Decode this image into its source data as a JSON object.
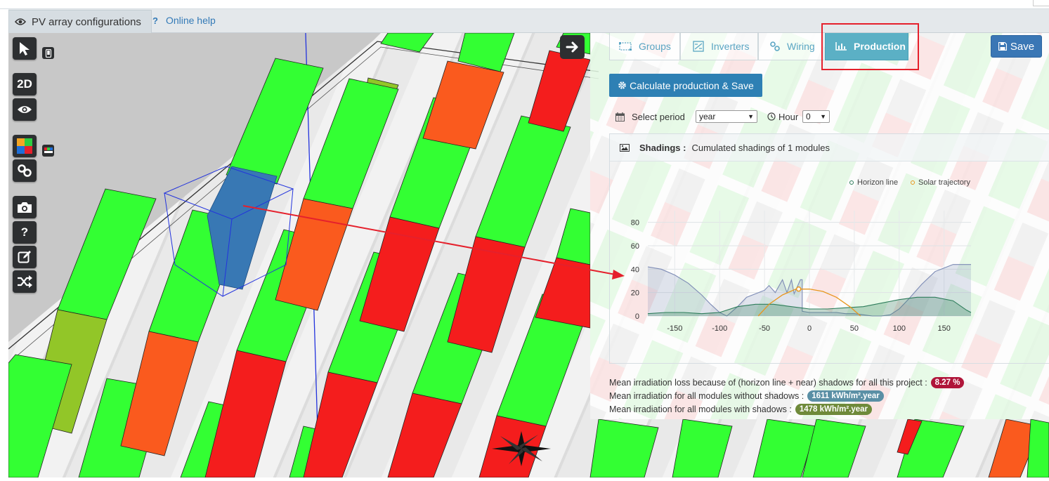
{
  "header": {
    "tab_label": "PV array configurations",
    "help_label": "Online help"
  },
  "toolbar": {
    "view_2d_label": "2D",
    "help_glyph": "?",
    "icons": [
      "cursor-icon",
      "mobile-icon",
      "eye-icon",
      "color-palette-icon",
      "color-bar-icon",
      "link-icon",
      "camera-icon",
      "question-icon",
      "edit-icon",
      "shuffle-icon",
      "arrow-right-icon"
    ]
  },
  "panel": {
    "tabs": [
      {
        "label": "Groups",
        "icon": "groups-icon"
      },
      {
        "label": "Inverters",
        "icon": "inverter-icon"
      },
      {
        "label": "Wiring",
        "icon": "wiring-icon"
      },
      {
        "label": "Production",
        "icon": "bar-chart-icon",
        "active": true
      }
    ],
    "save_label": "Save",
    "calculate_label": "Calculate production & Save",
    "select_period_label": "Select period",
    "period_value": "year",
    "hour_label": "Hour",
    "hour_value": "0"
  },
  "shadings": {
    "title": "Shadings :",
    "subtitle": "Cumulated shadings of 1 modules"
  },
  "chart_data": {
    "type": "area",
    "title": "",
    "xlabel": "",
    "ylabel": "",
    "xlim": [
      -180,
      180
    ],
    "ylim": [
      0,
      90
    ],
    "x_ticks": [
      -150,
      -100,
      -50,
      0,
      50,
      100,
      150
    ],
    "y_ticks": [
      0,
      20,
      40,
      60,
      80
    ],
    "grid": true,
    "legend_position": "top-right",
    "series": [
      {
        "name": "Horizon line",
        "color": "#2e7d5b",
        "x": [
          -180,
          -160,
          -140,
          -120,
          -100,
          -80,
          -60,
          -40,
          -20,
          0,
          20,
          40,
          60,
          80,
          100,
          120,
          140,
          160,
          175,
          180
        ],
        "y": [
          2,
          3,
          3,
          2,
          3,
          8,
          10,
          10,
          8,
          6,
          6,
          7,
          8,
          11,
          14,
          16,
          16,
          13,
          5,
          3
        ]
      },
      {
        "name": "Solar trajectory",
        "color": "#e8961e",
        "x": [
          -57,
          -45,
          -30,
          -15,
          0,
          15,
          30,
          45,
          57
        ],
        "y": [
          0,
          10,
          18,
          23,
          23,
          21,
          16,
          8,
          0
        ]
      },
      {
        "name": "",
        "color": "#7d8bb5",
        "x": [
          -180,
          -165,
          -150,
          -135,
          -120,
          -110,
          -100,
          -92,
          -80,
          -70,
          -60,
          -50,
          -45,
          -38,
          -30,
          -25,
          -20,
          -17,
          -10,
          -8,
          -8,
          0,
          10,
          20,
          30,
          40,
          50,
          60,
          70,
          80,
          90,
          100,
          110,
          125,
          140,
          160,
          180
        ],
        "y": [
          42,
          40,
          35,
          28,
          18,
          10,
          3,
          0,
          8,
          16,
          19,
          22,
          26,
          20,
          31,
          20,
          31,
          19,
          31,
          31,
          4,
          3,
          3,
          3,
          3,
          2,
          2,
          1,
          0,
          0,
          1,
          6,
          14,
          27,
          38,
          44,
          44
        ]
      }
    ]
  },
  "stats": {
    "loss_label": "Mean irradiation loss because of (horizon line + near) shadows for all this project :",
    "loss_value": "8.27 %",
    "without_label": "Mean irradiation for all modules without shadows :",
    "without_value": "1611 kWh/m².year",
    "with_label": "Mean irradiation for all modules with shadows :",
    "with_value": "1478 kWh/m².year"
  },
  "colors": {
    "module_green": "#33ff33",
    "module_red": "#f41d1d",
    "module_orange": "#fa5a1e",
    "module_olive": "#92c628",
    "module_selected": "#3878b4",
    "accent_blue": "#2e80b4",
    "tab_active": "#5bb0c5",
    "badge_loss": "#b0153a",
    "badge_without": "#5a8fa5",
    "badge_with": "#6f8a3a"
  }
}
